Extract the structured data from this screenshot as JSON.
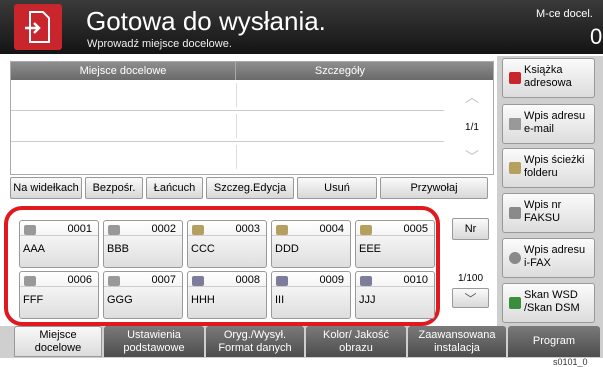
{
  "header": {
    "title": "Gotowa do wysłania.",
    "subtitle": "Wprowadź miejsce docelowe.",
    "dest_label": "M-ce docel.",
    "dest_count": "0"
  },
  "list": {
    "col_destination": "Miejsce docelowe",
    "col_details": "Szczegóły",
    "page": "1/1"
  },
  "right_buttons": [
    {
      "label": "Książka adresowa",
      "color": "#c8252c"
    },
    {
      "label": "Wpis adresu e-mail",
      "color": "#888888"
    },
    {
      "label": "Wpis ścieżki folderu",
      "color": "#888888"
    },
    {
      "label": "Wpis nr FAKSU",
      "color": "#888888"
    },
    {
      "label": "Wpis adresu i-FAX",
      "color": "#888888"
    },
    {
      "label": "Skan WSD /Skan DSM",
      "color": "#3a8d3a"
    }
  ],
  "ops": [
    "Na widełkach",
    "Bezpośr.",
    "Łańcuch",
    "Szczeg.Edycja",
    "Usuń",
    "Przywołaj"
  ],
  "keys": [
    {
      "num": "0001",
      "name": "AAA"
    },
    {
      "num": "0002",
      "name": "BBB"
    },
    {
      "num": "0003",
      "name": "CCC"
    },
    {
      "num": "0004",
      "name": "DDD"
    },
    {
      "num": "0005",
      "name": "EEE"
    },
    {
      "num": "0006",
      "name": "FFF"
    },
    {
      "num": "0007",
      "name": "GGG"
    },
    {
      "num": "0008",
      "name": "HHH"
    },
    {
      "num": "0009",
      "name": "III"
    },
    {
      "num": "0010",
      "name": "JJJ"
    }
  ],
  "nr_label": "Nr",
  "keys_page": "1/100",
  "tabs": [
    {
      "label": "Miejsce docelowe"
    },
    {
      "label": "Ustawienia podstawowe"
    },
    {
      "label": "Oryg./Wysył. Format danych"
    },
    {
      "label": "Kolor/ Jakość obrazu"
    },
    {
      "label": "Zaawansowana instalacja"
    },
    {
      "label": "Program"
    }
  ],
  "footnote": "s0101_0"
}
